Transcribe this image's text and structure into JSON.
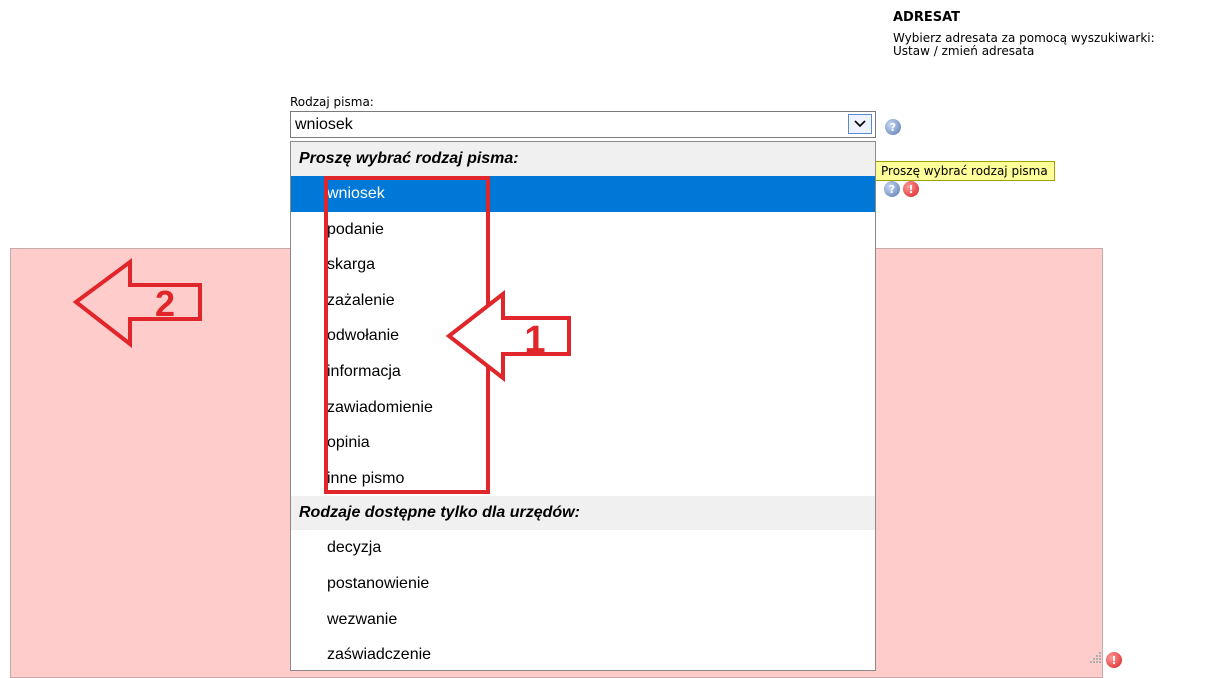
{
  "adresat": {
    "title": "ADRESAT",
    "help_line1": "Wybierz adresata za pomocą wyszukiwarki:",
    "help_line2": "Ustaw / zmień adresata"
  },
  "select": {
    "label": "Rodzaj pisma:",
    "value": "wniosek"
  },
  "tooltip": "Proszę wybrać rodzaj pisma",
  "dropdown": {
    "group1_header": "Proszę wybrać rodzaj pisma:",
    "group1_items": [
      "wniosek",
      "podanie",
      "skarga",
      "zażalenie",
      "odwołanie",
      "informacja",
      "zawiadomienie",
      "opinia",
      "inne pismo"
    ],
    "group2_header": "Rodzaje dostępne tylko dla urzędów:",
    "group2_items": [
      "decyzja",
      "postanowienie",
      "wezwanie",
      "zaświadczenie"
    ],
    "selected": "wniosek"
  },
  "annotations": {
    "arrow1_label": "1",
    "arrow2_label": "2",
    "color": "#e0262a"
  },
  "icons": {
    "help": "help-icon",
    "error": "error-icon",
    "dropdown": "chevron-down-icon",
    "resize": "resize-grip-icon"
  }
}
